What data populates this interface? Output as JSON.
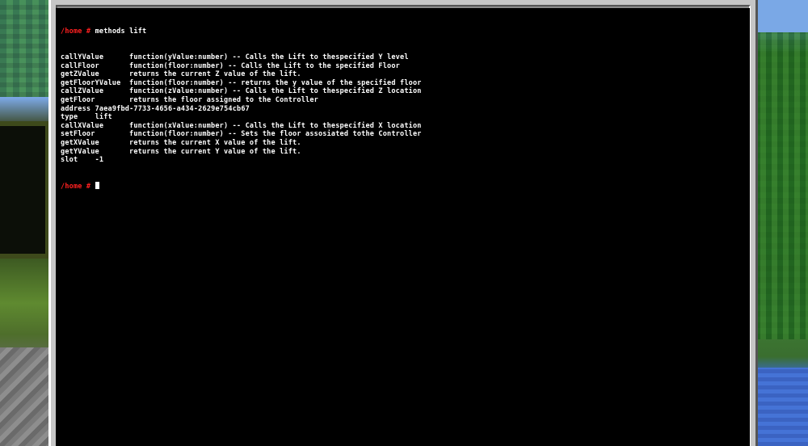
{
  "terminal": {
    "prompt": "/home #",
    "command": "methods lift",
    "rows": [
      {
        "name": "callYValue",
        "desc": "function(yValue:number) -- Calls the Lift to thespecified Y level"
      },
      {
        "name": "callFloor",
        "desc": "function(floor:number) -- Calls the Lift to the specified Floor"
      },
      {
        "name": "getZValue",
        "desc": "returns the current Z value of the lift."
      },
      {
        "name": "getFloorYValue",
        "desc": "function(floor:number) -- returns the y value of the specified floor"
      },
      {
        "name": "callZValue",
        "desc": "function(zValue:number) -- Calls the Lift to thespecified Z location"
      },
      {
        "name": "getFloor",
        "desc": "returns the floor assigned to the Controller"
      },
      {
        "name": "address",
        "desc": "7aea9fbd-7733-4656-a434-2629e754cb67",
        "inline": true
      },
      {
        "name": "type",
        "desc": "lift",
        "inline": true,
        "pad": "    "
      },
      {
        "name": "callXValue",
        "desc": "function(xValue:number) -- Calls the Lift to thespecified X location"
      },
      {
        "name": "setFloor",
        "desc": "function(floor:number) -- Sets the floor assosiated tothe Controller"
      },
      {
        "name": "getXValue",
        "desc": "returns the current X value of the lift."
      },
      {
        "name": "getYValue",
        "desc": "returns the current Y value of the lift."
      },
      {
        "name": "slot",
        "desc": "-1",
        "inline": true,
        "pad": "    "
      }
    ],
    "final_prompt": "/home #"
  },
  "colors": {
    "prompt": "#ff2020",
    "text": "#ffffff",
    "background": "#000000"
  }
}
